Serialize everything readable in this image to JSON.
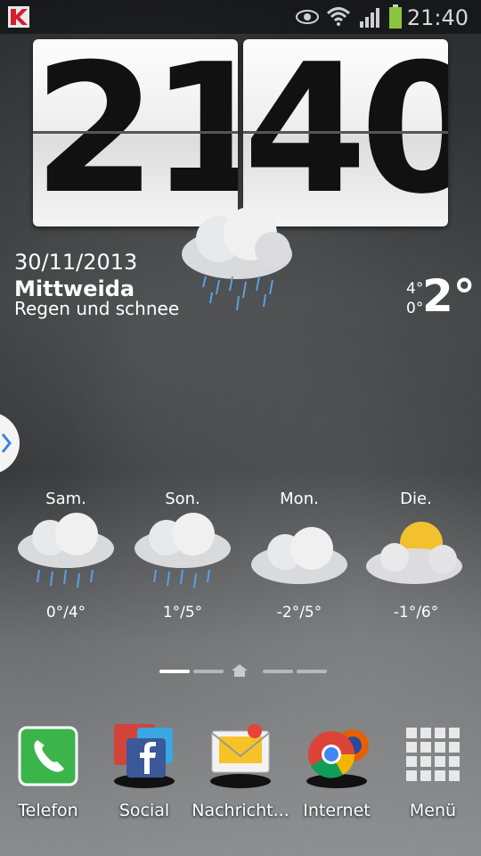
{
  "status_bar": {
    "time": "21:40",
    "icons": [
      "k-notification-icon",
      "eye-icon",
      "wifi-icon",
      "signal-icon",
      "battery-icon"
    ]
  },
  "clock": {
    "hours": "21",
    "minutes": "40"
  },
  "weather": {
    "date": "30/11/2013",
    "city": "Mittweida",
    "condition": "Regen und schnee",
    "high": "4°",
    "low": "0°",
    "current": "2°",
    "icon": "cloud-rain-icon"
  },
  "forecast": [
    {
      "day": "Sam.",
      "temp": "0°/4°",
      "icon": "cloud-rain-icon"
    },
    {
      "day": "Son.",
      "temp": "1°/5°",
      "icon": "cloud-rain-icon"
    },
    {
      "day": "Mon.",
      "temp": "-2°/5°",
      "icon": "cloud-icon"
    },
    {
      "day": "Die.",
      "temp": "-1°/6°",
      "icon": "sun-cloud-icon"
    }
  ],
  "pager": {
    "pages": 5,
    "home_index": 2,
    "active_index": 0
  },
  "dock": [
    {
      "label": "Telefon",
      "icon": "phone-icon"
    },
    {
      "label": "Social",
      "icon": "social-folder-icon"
    },
    {
      "label": "Nachricht...",
      "icon": "messages-icon"
    },
    {
      "label": "Internet",
      "icon": "browser-folder-icon"
    },
    {
      "label": "Menü",
      "icon": "app-drawer-icon"
    }
  ],
  "colors": {
    "status_bg": "#000000",
    "accent_blue": "#3a86d8",
    "battery": "#8bc53f",
    "phone_green": "#3bb54a"
  }
}
